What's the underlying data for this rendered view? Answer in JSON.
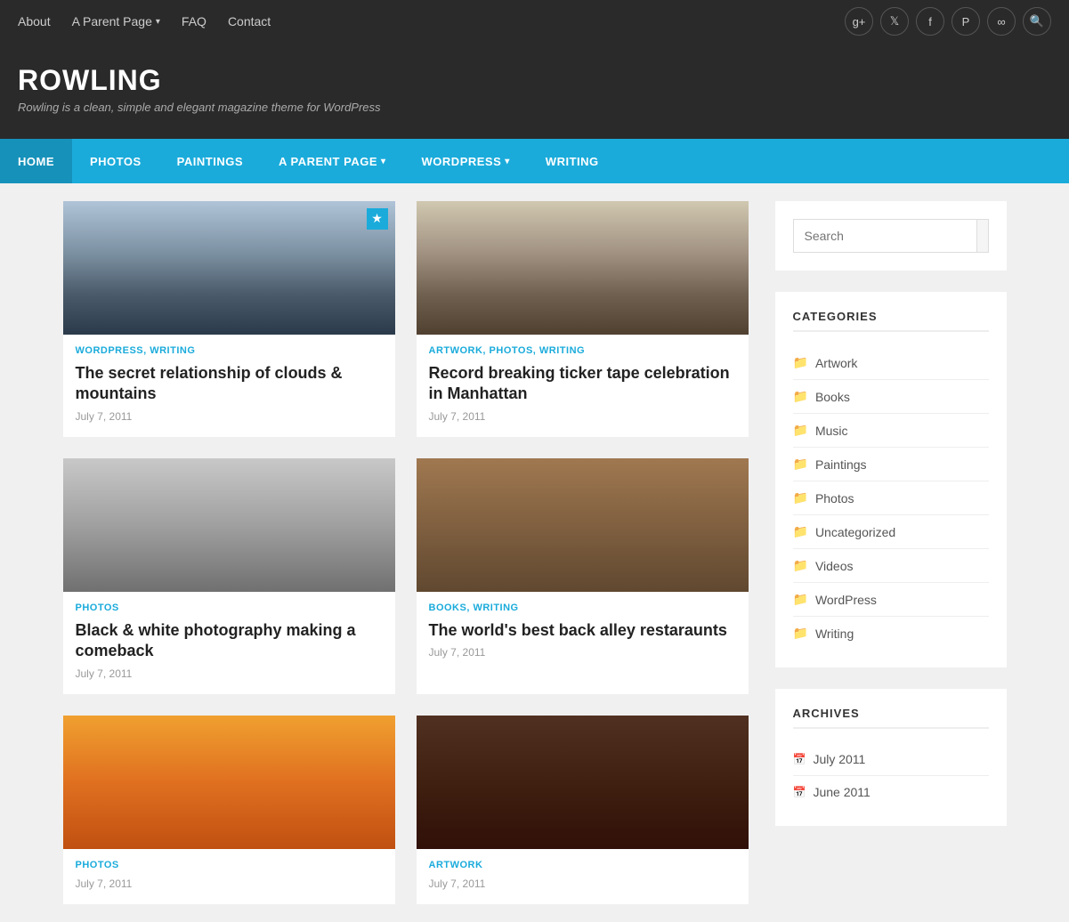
{
  "site": {
    "title": "ROWLING",
    "tagline": "Rowling is a clean, simple and elegant magazine theme for WordPress"
  },
  "top_nav": {
    "items": [
      {
        "label": "About",
        "has_dropdown": false
      },
      {
        "label": "A Parent Page",
        "has_dropdown": true
      },
      {
        "label": "FAQ",
        "has_dropdown": false
      },
      {
        "label": "Contact",
        "has_dropdown": false
      }
    ]
  },
  "social_icons": [
    {
      "name": "google-plus-icon",
      "symbol": "g+"
    },
    {
      "name": "twitter-icon",
      "symbol": "t"
    },
    {
      "name": "facebook-icon",
      "symbol": "f"
    },
    {
      "name": "pinterest-icon",
      "symbol": "p"
    },
    {
      "name": "link-icon",
      "symbol": "∞"
    },
    {
      "name": "search-icon",
      "symbol": "🔍"
    }
  ],
  "main_nav": {
    "items": [
      {
        "label": "HOME",
        "active": true
      },
      {
        "label": "PHOTOS",
        "active": false
      },
      {
        "label": "PAINTINGS",
        "active": false
      },
      {
        "label": "A PARENT PAGE",
        "active": false,
        "has_dropdown": true
      },
      {
        "label": "WORDPRESS",
        "active": false,
        "has_dropdown": true
      },
      {
        "label": "WRITING",
        "active": false
      }
    ]
  },
  "posts": [
    {
      "categories": "WORDPRESS, WRITING",
      "title": "The secret relationship of clouds & mountains",
      "date": "July 7, 2011",
      "img_class": "img-mountains",
      "has_bookmark": true
    },
    {
      "categories": "ARTWORK, PHOTOS, WRITING",
      "title": "Record breaking ticker tape celebration in Manhattan",
      "date": "July 7, 2011",
      "img_class": "img-crowd",
      "has_bookmark": false
    },
    {
      "categories": "PHOTOS",
      "title": "Black & white photography making a comeback",
      "date": "July 7, 2011",
      "img_class": "img-office",
      "has_bookmark": false
    },
    {
      "categories": "BOOKS, WRITING",
      "title": "The world's best back alley restaraunts",
      "date": "July 7, 2011",
      "img_class": "img-alley",
      "has_bookmark": false
    },
    {
      "categories": "PHOTOS",
      "title": "",
      "date": "July 7, 2011",
      "img_class": "img-sunset",
      "has_bookmark": false
    },
    {
      "categories": "ARTWORK",
      "title": "",
      "date": "July 7, 2011",
      "img_class": "img-dark",
      "has_bookmark": false
    }
  ],
  "sidebar": {
    "search_placeholder": "Search",
    "search_btn_label": "🔍",
    "categories_title": "CATEGORIES",
    "categories": [
      {
        "label": "Artwork"
      },
      {
        "label": "Books"
      },
      {
        "label": "Music"
      },
      {
        "label": "Paintings"
      },
      {
        "label": "Photos"
      },
      {
        "label": "Uncategorized"
      },
      {
        "label": "Videos"
      },
      {
        "label": "WordPress"
      },
      {
        "label": "Writing"
      }
    ],
    "archives_title": "ARCHIVES",
    "archives": [
      {
        "label": "July 2011"
      },
      {
        "label": "June 2011"
      }
    ]
  }
}
